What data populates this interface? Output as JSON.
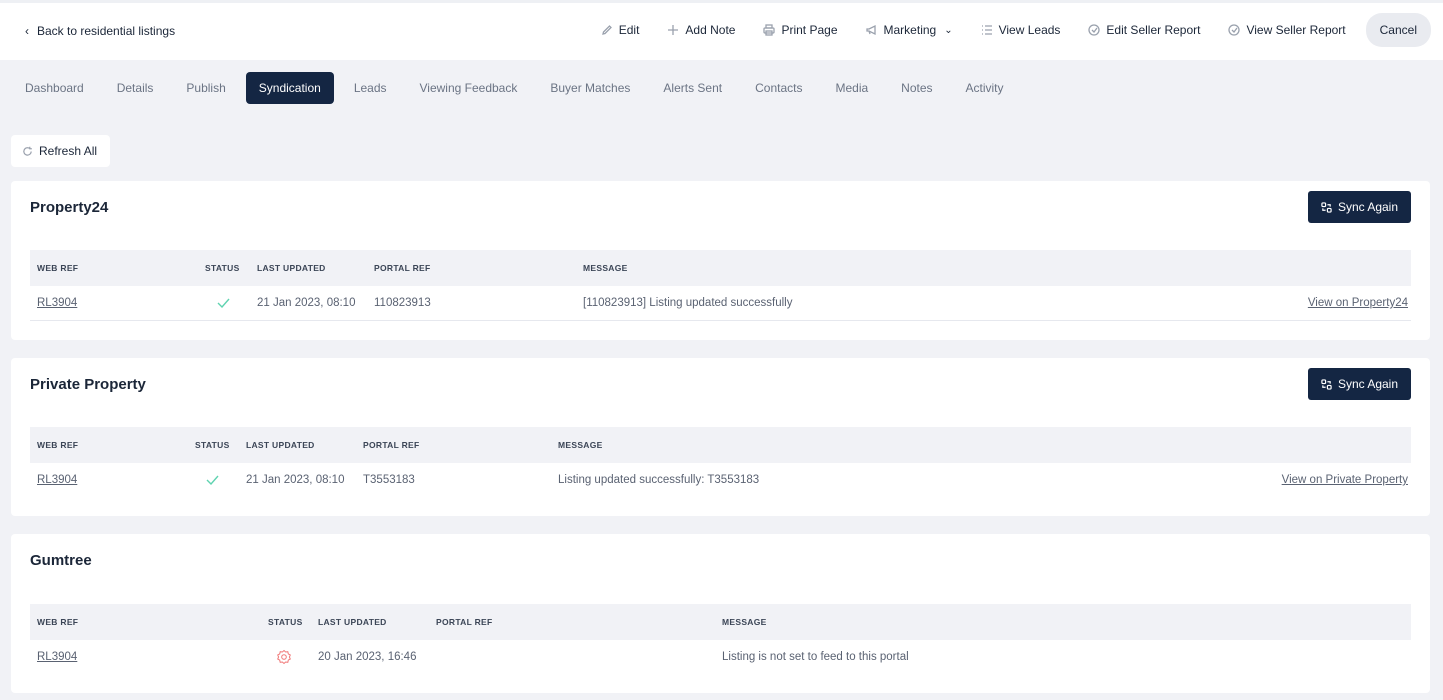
{
  "header": {
    "back_label": "Back to residential listings",
    "actions": {
      "edit": "Edit",
      "add_note": "Add Note",
      "print_page": "Print Page",
      "marketing": "Marketing",
      "view_leads": "View Leads",
      "edit_seller_report": "Edit Seller Report",
      "view_seller_report": "View Seller Report",
      "cancel": "Cancel"
    }
  },
  "tabs": [
    {
      "label": "Dashboard",
      "active": false
    },
    {
      "label": "Details",
      "active": false
    },
    {
      "label": "Publish",
      "active": false
    },
    {
      "label": "Syndication",
      "active": true
    },
    {
      "label": "Leads",
      "active": false
    },
    {
      "label": "Viewing Feedback",
      "active": false
    },
    {
      "label": "Buyer Matches",
      "active": false
    },
    {
      "label": "Alerts Sent",
      "active": false
    },
    {
      "label": "Contacts",
      "active": false
    },
    {
      "label": "Media",
      "active": false
    },
    {
      "label": "Notes",
      "active": false
    },
    {
      "label": "Activity",
      "active": false
    }
  ],
  "refresh_label": "Refresh All",
  "columns": {
    "web_ref": "WEB REF",
    "status": "STATUS",
    "last_updated": "LAST UPDATED",
    "portal_ref": "PORTAL REF",
    "message": "MESSAGE"
  },
  "portals": [
    {
      "name": "Property24",
      "sync_label": "Sync Again",
      "row": {
        "web_ref": "RL3904",
        "status": "success",
        "last_updated": "21 Jan 2023, 08:10",
        "portal_ref": "110823913",
        "message": "[110823913] Listing updated successfully",
        "view_link": "View on Property24"
      }
    },
    {
      "name": "Private Property",
      "sync_label": "Sync Again",
      "row": {
        "web_ref": "RL3904",
        "status": "success",
        "last_updated": "21 Jan 2023, 08:10",
        "portal_ref": "T3553183",
        "message": "Listing updated successfully: T3553183",
        "view_link": "View on Private Property"
      }
    },
    {
      "name": "Gumtree",
      "row": {
        "web_ref": "RL3904",
        "status": "error",
        "last_updated": "20 Jan 2023, 16:46",
        "portal_ref": "",
        "message": "Listing is not set to feed to this portal"
      }
    }
  ],
  "colors": {
    "navy": "#142643",
    "success": "#5fd3b0",
    "error": "#f07a7a"
  }
}
